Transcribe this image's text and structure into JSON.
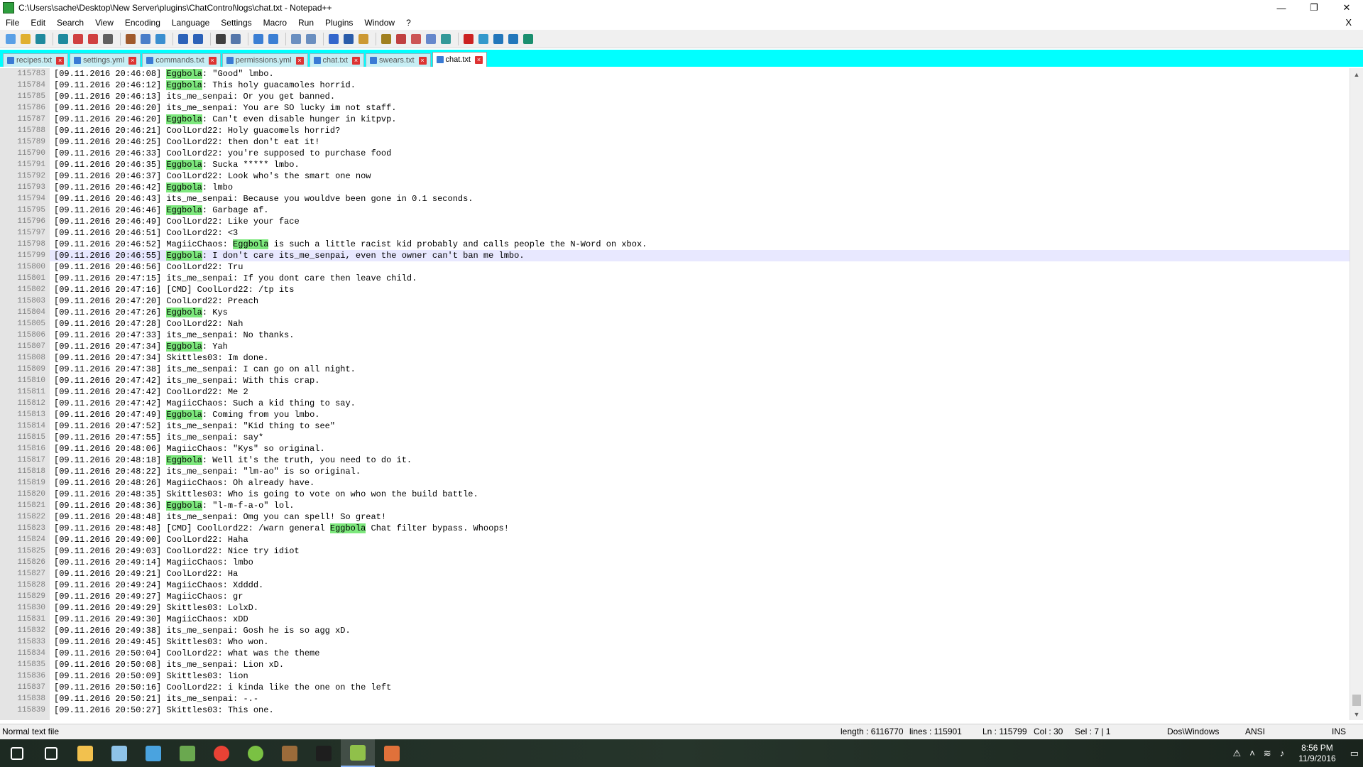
{
  "window": {
    "title": "C:\\Users\\sache\\Desktop\\New Server\\plugins\\ChatControl\\logs\\chat.txt - Notepad++",
    "minimize": "—",
    "maximize": "❐",
    "close": "✕"
  },
  "menu": {
    "items": [
      "File",
      "Edit",
      "Search",
      "View",
      "Encoding",
      "Language",
      "Settings",
      "Macro",
      "Run",
      "Plugins",
      "Window",
      "?"
    ],
    "close_doc": "X"
  },
  "toolbar": {
    "icons": [
      "new-file-icon",
      "open-file-icon",
      "save-icon",
      "save-all-icon",
      "close-icon",
      "close-all-icon",
      "print-icon",
      "cut-icon",
      "copy-icon",
      "paste-icon",
      "undo-icon",
      "redo-icon",
      "find-icon",
      "replace-icon",
      "zoom-in-icon",
      "zoom-out-icon",
      "sync-v-icon",
      "sync-h-icon",
      "word-wrap-icon",
      "show-all-chars-icon",
      "indent-guide-icon",
      "lang-icon",
      "doc-map-icon",
      "function-list-icon",
      "folder-workspace-icon",
      "monitor-icon",
      "record-macro-icon",
      "stop-macro-icon",
      "play-macro-icon",
      "run-macro-multi-icon",
      "save-macro-icon"
    ]
  },
  "tabs": [
    {
      "label": "recipes.txt",
      "active": false
    },
    {
      "label": "settings.yml",
      "active": false
    },
    {
      "label": "commands.txt",
      "active": false
    },
    {
      "label": "permissions.yml",
      "active": false
    },
    {
      "label": "chat.txt",
      "active": false
    },
    {
      "label": "swears.txt",
      "active": false
    },
    {
      "label": "chat.txt",
      "active": true
    }
  ],
  "highlight_word": "Eggbola",
  "current_line": 115799,
  "lines": [
    {
      "n": "115783",
      "t": "[09.11.2016 20:46:08] Eggbola: \"Good\" lmbo."
    },
    {
      "n": "115784",
      "t": "[09.11.2016 20:46:12] Eggbola: This holy guacamoles horrid."
    },
    {
      "n": "115785",
      "t": "[09.11.2016 20:46:13] its_me_senpai: Or you get banned."
    },
    {
      "n": "115786",
      "t": "[09.11.2016 20:46:20] its_me_senpai: You are SO lucky im not staff."
    },
    {
      "n": "115787",
      "t": "[09.11.2016 20:46:20] Eggbola: Can't even disable hunger in kitpvp."
    },
    {
      "n": "115788",
      "t": "[09.11.2016 20:46:21] CoolLord22: Holy guacomels horrid?"
    },
    {
      "n": "115789",
      "t": "[09.11.2016 20:46:25] CoolLord22: then don't eat it!"
    },
    {
      "n": "115790",
      "t": "[09.11.2016 20:46:33] CoolLord22: you're supposed to purchase food"
    },
    {
      "n": "115791",
      "t": "[09.11.2016 20:46:35] Eggbola: Sucka ***** lmbo."
    },
    {
      "n": "115792",
      "t": "[09.11.2016 20:46:37] CoolLord22: Look who's the smart one now"
    },
    {
      "n": "115793",
      "t": "[09.11.2016 20:46:42] Eggbola: lmbo"
    },
    {
      "n": "115794",
      "t": "[09.11.2016 20:46:43] its_me_senpai: Because you wouldve been gone in 0.1 seconds."
    },
    {
      "n": "115795",
      "t": "[09.11.2016 20:46:46] Eggbola: Garbage af."
    },
    {
      "n": "115796",
      "t": "[09.11.2016 20:46:49] CoolLord22: Like your face"
    },
    {
      "n": "115797",
      "t": "[09.11.2016 20:46:51] CoolLord22: <3"
    },
    {
      "n": "115798",
      "t": "[09.11.2016 20:46:52] MagiicChaos: Eggbola is such a little racist kid probably and calls people the N-Word on xbox."
    },
    {
      "n": "115799",
      "t": "[09.11.2016 20:46:55] Eggbola: I don't care its_me_senpai, even the owner can't ban me lmbo."
    },
    {
      "n": "115800",
      "t": "[09.11.2016 20:46:56] CoolLord22: Tru"
    },
    {
      "n": "115801",
      "t": "[09.11.2016 20:47:15] its_me_senpai: If you dont care then leave child."
    },
    {
      "n": "115802",
      "t": "[09.11.2016 20:47:16] [CMD] CoolLord22: /tp its"
    },
    {
      "n": "115803",
      "t": "[09.11.2016 20:47:20] CoolLord22: Preach"
    },
    {
      "n": "115804",
      "t": "[09.11.2016 20:47:26] Eggbola: Kys"
    },
    {
      "n": "115805",
      "t": "[09.11.2016 20:47:28] CoolLord22: Nah"
    },
    {
      "n": "115806",
      "t": "[09.11.2016 20:47:33] its_me_senpai: No thanks."
    },
    {
      "n": "115807",
      "t": "[09.11.2016 20:47:34] Eggbola: Yah"
    },
    {
      "n": "115808",
      "t": "[09.11.2016 20:47:34] Skittles03: Im done."
    },
    {
      "n": "115809",
      "t": "[09.11.2016 20:47:38] its_me_senpai: I can go on all night."
    },
    {
      "n": "115810",
      "t": "[09.11.2016 20:47:42] its_me_senpai: With this crap."
    },
    {
      "n": "115811",
      "t": "[09.11.2016 20:47:42] CoolLord22: Me 2"
    },
    {
      "n": "115812",
      "t": "[09.11.2016 20:47:42] MagiicChaos: Such a kid thing to say."
    },
    {
      "n": "115813",
      "t": "[09.11.2016 20:47:49] Eggbola: Coming from you lmbo."
    },
    {
      "n": "115814",
      "t": "[09.11.2016 20:47:52] its_me_senpai: \"Kid thing to see\""
    },
    {
      "n": "115815",
      "t": "[09.11.2016 20:47:55] its_me_senpai: say*"
    },
    {
      "n": "115816",
      "t": "[09.11.2016 20:48:06] MagiicChaos: \"Kys\" so original."
    },
    {
      "n": "115817",
      "t": "[09.11.2016 20:48:18] Eggbola: Well it's the truth, you need to do it."
    },
    {
      "n": "115818",
      "t": "[09.11.2016 20:48:22] its_me_senpai: \"lm-ao\" is so original."
    },
    {
      "n": "115819",
      "t": "[09.11.2016 20:48:26] MagiicChaos: Oh already have."
    },
    {
      "n": "115820",
      "t": "[09.11.2016 20:48:35] Skittles03: Who is going to vote on who won the build battle."
    },
    {
      "n": "115821",
      "t": "[09.11.2016 20:48:36] Eggbola: \"l-m-f-a-o\" lol."
    },
    {
      "n": "115822",
      "t": "[09.11.2016 20:48:48] its_me_senpai: Omg you can spell! So great!"
    },
    {
      "n": "115823",
      "t": "[09.11.2016 20:48:48] [CMD] CoolLord22: /warn general Eggbola Chat filter bypass. Whoops!"
    },
    {
      "n": "115824",
      "t": "[09.11.2016 20:49:00] CoolLord22: Haha"
    },
    {
      "n": "115825",
      "t": "[09.11.2016 20:49:03] CoolLord22: Nice try idiot"
    },
    {
      "n": "115826",
      "t": "[09.11.2016 20:49:14] MagiicChaos: lmbo"
    },
    {
      "n": "115827",
      "t": "[09.11.2016 20:49:21] CoolLord22: Ha"
    },
    {
      "n": "115828",
      "t": "[09.11.2016 20:49:24] MagiicChaos: Xdddd."
    },
    {
      "n": "115829",
      "t": "[09.11.2016 20:49:27] MagiicChaos: gr"
    },
    {
      "n": "115830",
      "t": "[09.11.2016 20:49:29] Skittles03: LolxD."
    },
    {
      "n": "115831",
      "t": "[09.11.2016 20:49:30] MagiicChaos: xDD"
    },
    {
      "n": "115832",
      "t": "[09.11.2016 20:49:38] its_me_senpai: Gosh he is so agg xD."
    },
    {
      "n": "115833",
      "t": "[09.11.2016 20:49:45] Skittles03: Who won."
    },
    {
      "n": "115834",
      "t": "[09.11.2016 20:50:04] CoolLord22: what was the theme"
    },
    {
      "n": "115835",
      "t": "[09.11.2016 20:50:08] its_me_senpai: Lion xD."
    },
    {
      "n": "115836",
      "t": "[09.11.2016 20:50:09] Skittles03: lion"
    },
    {
      "n": "115837",
      "t": "[09.11.2016 20:50:16] CoolLord22: i kinda like the one on the left"
    },
    {
      "n": "115838",
      "t": "[09.11.2016 20:50:21] its_me_senpai: -.-"
    },
    {
      "n": "115839",
      "t": "[09.11.2016 20:50:27] Skittles03: This one."
    }
  ],
  "status": {
    "file_type": "Normal text file",
    "length": "length : 6116770",
    "lines": "lines : 115901",
    "ln": "Ln : 115799",
    "col": "Col : 30",
    "sel": "Sel : 7 | 1",
    "eol": "Dos\\Windows",
    "encoding": "ANSI",
    "mode": "INS"
  },
  "taskbar": {
    "apps": [
      "start-icon",
      "task-view-icon",
      "file-explorer-icon",
      "notepad-icon",
      "store-icon",
      "minecraft-icon",
      "chrome-icon",
      "green-app-icon",
      "package-icon",
      "terminal-icon",
      "notepadpp-icon",
      "calculator-icon"
    ],
    "active_app": "notepadpp-icon",
    "time": "8:56 PM",
    "date": "11/9/2016"
  }
}
